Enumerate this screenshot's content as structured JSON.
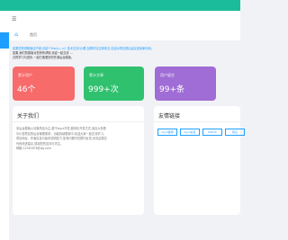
{
  "header": {
    "menu_icon": "menu-icon"
  },
  "tabbar": {
    "home_icon": "home-icon",
    "tab_label": "首页"
  },
  "notice": {
    "line1": "如果您觉得模版还不错,请给个Star(⊙ˍ⊙)! 技术交流QQ群,加群时请注明来意,欢迎对项目提出建议或贡献代码。",
    "line2": "如果,我们的模版对您有所帮助,欢迎一起交流 ...",
    "line3": "共同学习与进步,一起打造更好的开源后台模版。"
  },
  "cards": [
    {
      "title": "累计用户",
      "value": "46个",
      "color": "#f76b6b"
    },
    {
      "title": "累计文章",
      "value": "999+次",
      "color": "#2fc16e"
    },
    {
      "title": "用户留言",
      "value": "99+条",
      "color": "#a06cd5"
    }
  ],
  "about": {
    "title": "关于我们",
    "lines": [
      "本后台模版以清爽简洁为主,基于layui开发,模块化开发方式,适合大多数",
      "中小型项目的后台管理需求。功能持续更新中,欢迎大家一起交流学习。",
      "项目地址、作者信息与版本说明如下,如有问题可在群内反馈,也欢迎提交",
      "代码改进建议,感谢您的支持与关注。",
      "邮箱:12345678@qq.com"
    ]
  },
  "friend_links": {
    "title": "友情链接",
    "items": [
      "layui官网",
      "layui社区",
      "Github",
      "码云"
    ]
  }
}
